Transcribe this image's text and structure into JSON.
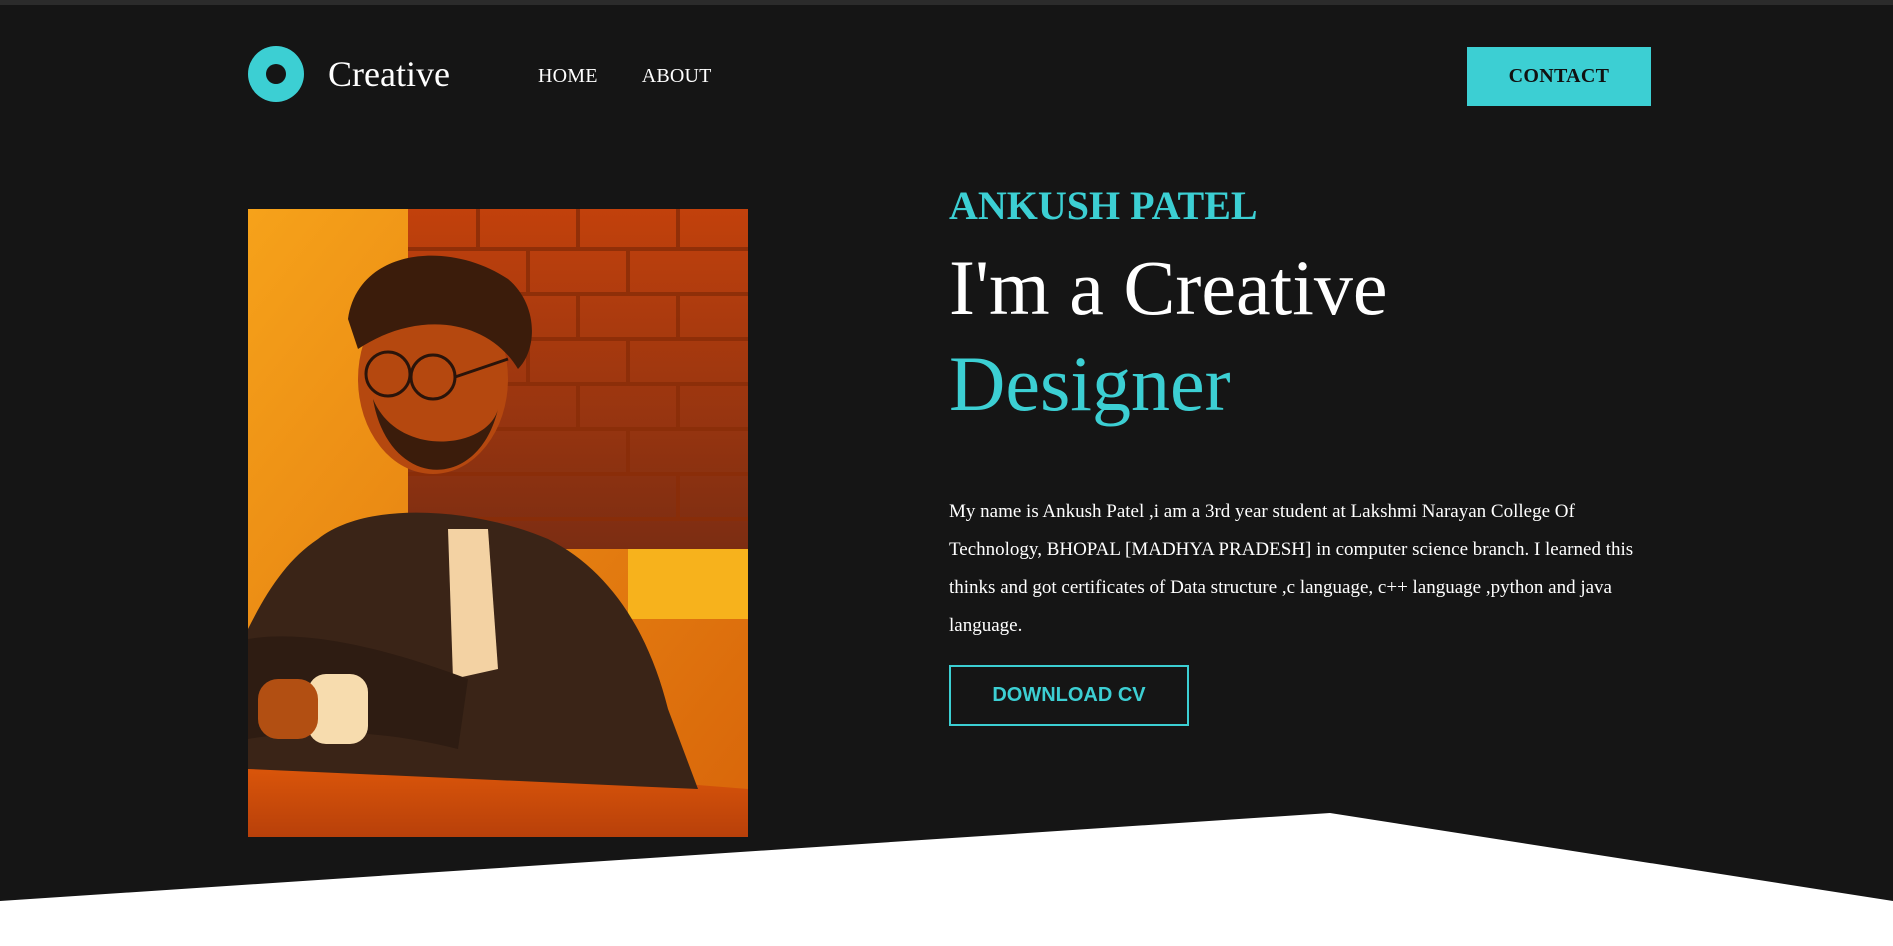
{
  "theme": {
    "accent": "#3ccfd3",
    "background": "#151515",
    "text": "#ffffff"
  },
  "header": {
    "brand_name": "Creative",
    "logo_icon": "ring-logo-icon",
    "nav": [
      {
        "label": "HOME"
      },
      {
        "label": "ABOUT"
      }
    ],
    "contact_label": "CONTACT"
  },
  "hero": {
    "photo_alt": "portrait-photo",
    "name": "ANKUSH PATEL",
    "headline_line1": "I'm a Creative",
    "headline_line2": "Designer",
    "bio": "My name is Ankush Patel ,i am a 3rd year student at Lakshmi Narayan College Of Technology, BHOPAL [MADHYA PRADESH] in computer science branch. I learned this thinks and got certificates of Data structure ,c language, c++ language ,python and java language.",
    "download_label": "DOWNLOAD CV"
  }
}
